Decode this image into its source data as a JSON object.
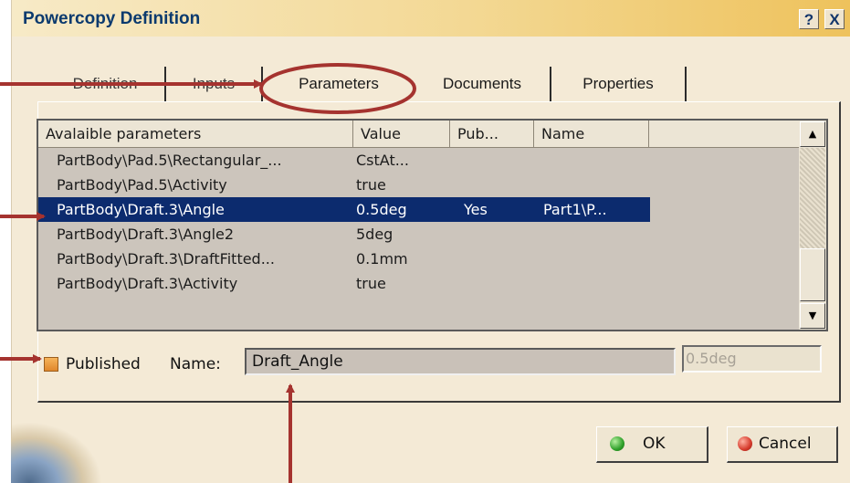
{
  "window": {
    "title": "Powercopy Definition",
    "help_label": "?",
    "close_label": "X"
  },
  "tabs": [
    {
      "label": "Definition"
    },
    {
      "label": "Inputs"
    },
    {
      "label": "Parameters",
      "active": true
    },
    {
      "label": "Documents"
    },
    {
      "label": "Properties"
    }
  ],
  "parameters_table": {
    "columns": [
      "Avalaible parameters",
      "Value",
      "Pub...",
      "Name"
    ],
    "rows": [
      {
        "param": "PartBody\\Pad.5\\Rectangular_...",
        "value": "CstAt...",
        "pub": "",
        "name": ""
      },
      {
        "param": "PartBody\\Pad.5\\Activity",
        "value": "true",
        "pub": "",
        "name": ""
      },
      {
        "param": "PartBody\\Draft.3\\Angle",
        "value": "0.5deg",
        "pub": "Yes",
        "name": "Part1\\P...",
        "selected": true
      },
      {
        "param": "PartBody\\Draft.3\\Angle2",
        "value": "5deg",
        "pub": "",
        "name": ""
      },
      {
        "param": "PartBody\\Draft.3\\DraftFitted...",
        "value": "0.1mm",
        "pub": "",
        "name": ""
      },
      {
        "param": "PartBody\\Draft.3\\Activity",
        "value": "true",
        "pub": "",
        "name": ""
      }
    ],
    "scroll_up_icon": "triangle-up-icon",
    "scroll_down_icon": "triangle-down-icon"
  },
  "published": {
    "label": "Published",
    "checked": true,
    "name_label": "Name:",
    "name_value": "Draft_Angle",
    "value_display": "0.5deg"
  },
  "buttons": {
    "ok_label": "OK",
    "cancel_label": "Cancel"
  },
  "colors": {
    "selection": "#0c2b6e",
    "annotation": "#a5332f",
    "ok_icon": "#2fa02a",
    "cancel_icon": "#d63b2c"
  }
}
